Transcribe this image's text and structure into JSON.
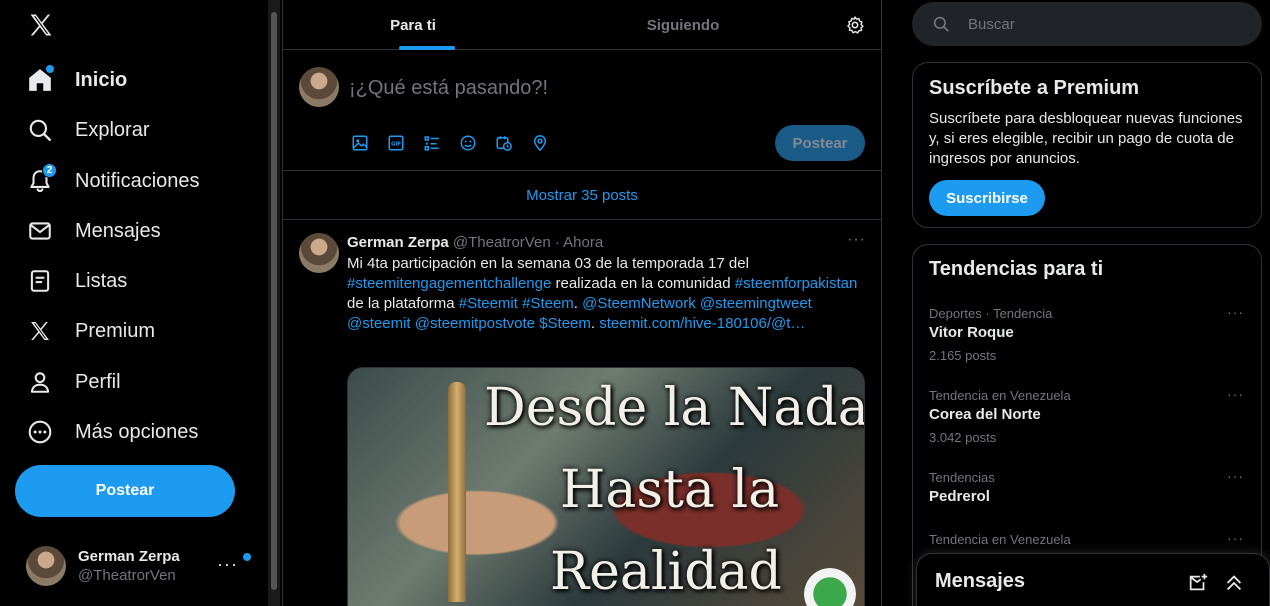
{
  "colors": {
    "accent": "#1d9bf0",
    "background": "#000000",
    "text": "#e7e9ea",
    "muted": "#71767b",
    "border": "#2f3336"
  },
  "nav": {
    "logo_icon": "x-logo-icon",
    "items": [
      {
        "label": "Inicio",
        "icon": "home-icon",
        "active": true
      },
      {
        "label": "Explorar",
        "icon": "search-icon"
      },
      {
        "label": "Notificaciones",
        "icon": "bell-icon",
        "badge": "2"
      },
      {
        "label": "Mensajes",
        "icon": "envelope-icon"
      },
      {
        "label": "Listas",
        "icon": "list-icon"
      },
      {
        "label": "Premium",
        "icon": "x-logo-icon"
      },
      {
        "label": "Perfil",
        "icon": "person-icon"
      },
      {
        "label": "Más opciones",
        "icon": "more-circle-icon"
      }
    ],
    "post_button": "Postear",
    "account": {
      "name": "German Zerpa",
      "handle": "@TheatrorVen",
      "more": "···"
    }
  },
  "main": {
    "tabs": [
      {
        "label": "Para ti",
        "active": true
      },
      {
        "label": "Siguiendo"
      }
    ],
    "composer": {
      "placeholder": "¡¿Qué está pasando?!",
      "post_button": "Postear"
    },
    "show_posts": "Mostrar 35 posts",
    "post": {
      "author": "German Zerpa",
      "handle_time": "@TheatrorVen · Ahora",
      "more": "···",
      "t1": "Mi 4ta participación en la semana 03 de la temporada 17 del ",
      "l1": "#steemitengagementchallenge",
      "t2": " realizada en la comunidad ",
      "l2": "#steemforpakistan",
      "t3": " de la plataforma ",
      "l3": "#Steemit #Steem",
      "t4": ". ",
      "l4": "@SteemNetwork @steemingtweet @steemit @steemitpostvote $Steem",
      "t5": ". ",
      "l5": "steemit.com/hive-180106/@t…",
      "image_text": [
        "Desde la Nada",
        "Hasta la",
        "Realidad"
      ]
    }
  },
  "right": {
    "search_placeholder": "Buscar",
    "premium": {
      "title": "Suscríbete a Premium",
      "desc": "Suscríbete para desbloquear nuevas funciones y, si eres elegible, recibir un pago de cuota de ingresos por anuncios.",
      "button": "Suscribirse"
    },
    "trends": {
      "title": "Tendencias para ti",
      "items": [
        {
          "context": "Deportes · Tendencia",
          "name": "Vitor Roque",
          "count": "2.165 posts",
          "more": "···"
        },
        {
          "context": "Tendencia en Venezuela",
          "name": "Corea del Norte",
          "count": "3.042 posts",
          "more": "···"
        },
        {
          "context": "Tendencias",
          "name": "Pedrerol",
          "count": "",
          "more": "···"
        },
        {
          "context": "Tendencia en Venezuela",
          "name": "",
          "count": "",
          "more": "···"
        }
      ]
    },
    "messages_drawer": "Mensajes"
  }
}
